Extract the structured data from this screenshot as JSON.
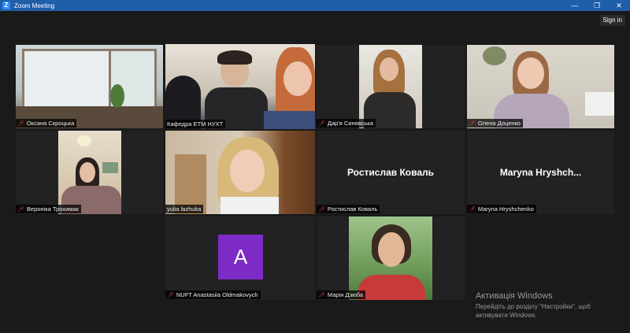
{
  "window": {
    "title": "Zoom Meeting",
    "controls": {
      "minimize": "—",
      "restore": "❐",
      "close": "✕"
    }
  },
  "signin_label": "Sign in",
  "participants": [
    {
      "name": "Оксана Скроцька",
      "muted": true
    },
    {
      "name": "Кафедра ЕТМ НУХТ",
      "muted": false,
      "active_speaker": true
    },
    {
      "name": "Дар'я Синявська",
      "muted": true
    },
    {
      "name": "Олена Доценко",
      "muted": true
    },
    {
      "name": "Вероніка Трохимак",
      "muted": true
    },
    {
      "name": "yulia lazhuka",
      "muted": false
    },
    {
      "name": "Ростислав Коваль",
      "display_name": "Ростислав Коваль",
      "muted": true,
      "video_off": true
    },
    {
      "name": "Maryna Hryshchenko",
      "display_name": "Maryna  Hryshch...",
      "muted": true,
      "video_off": true
    },
    {
      "name": "NUFT Anastasiia Oldmakovych",
      "avatar_letter": "A",
      "muted": true,
      "video_off": true
    },
    {
      "name": "Марія Дзюба",
      "muted": true
    }
  ],
  "watermark": {
    "line1": "Активація Windows",
    "line2": "Перейдіть до розділу \"Настройки\", щоб активувати Windows."
  },
  "colors": {
    "background": "#1a1a1a",
    "titlebar": "#1f5ea8",
    "active_border": "#c8e62e",
    "avatar": "#7d2bc6",
    "muted_icon": "#e53935"
  }
}
